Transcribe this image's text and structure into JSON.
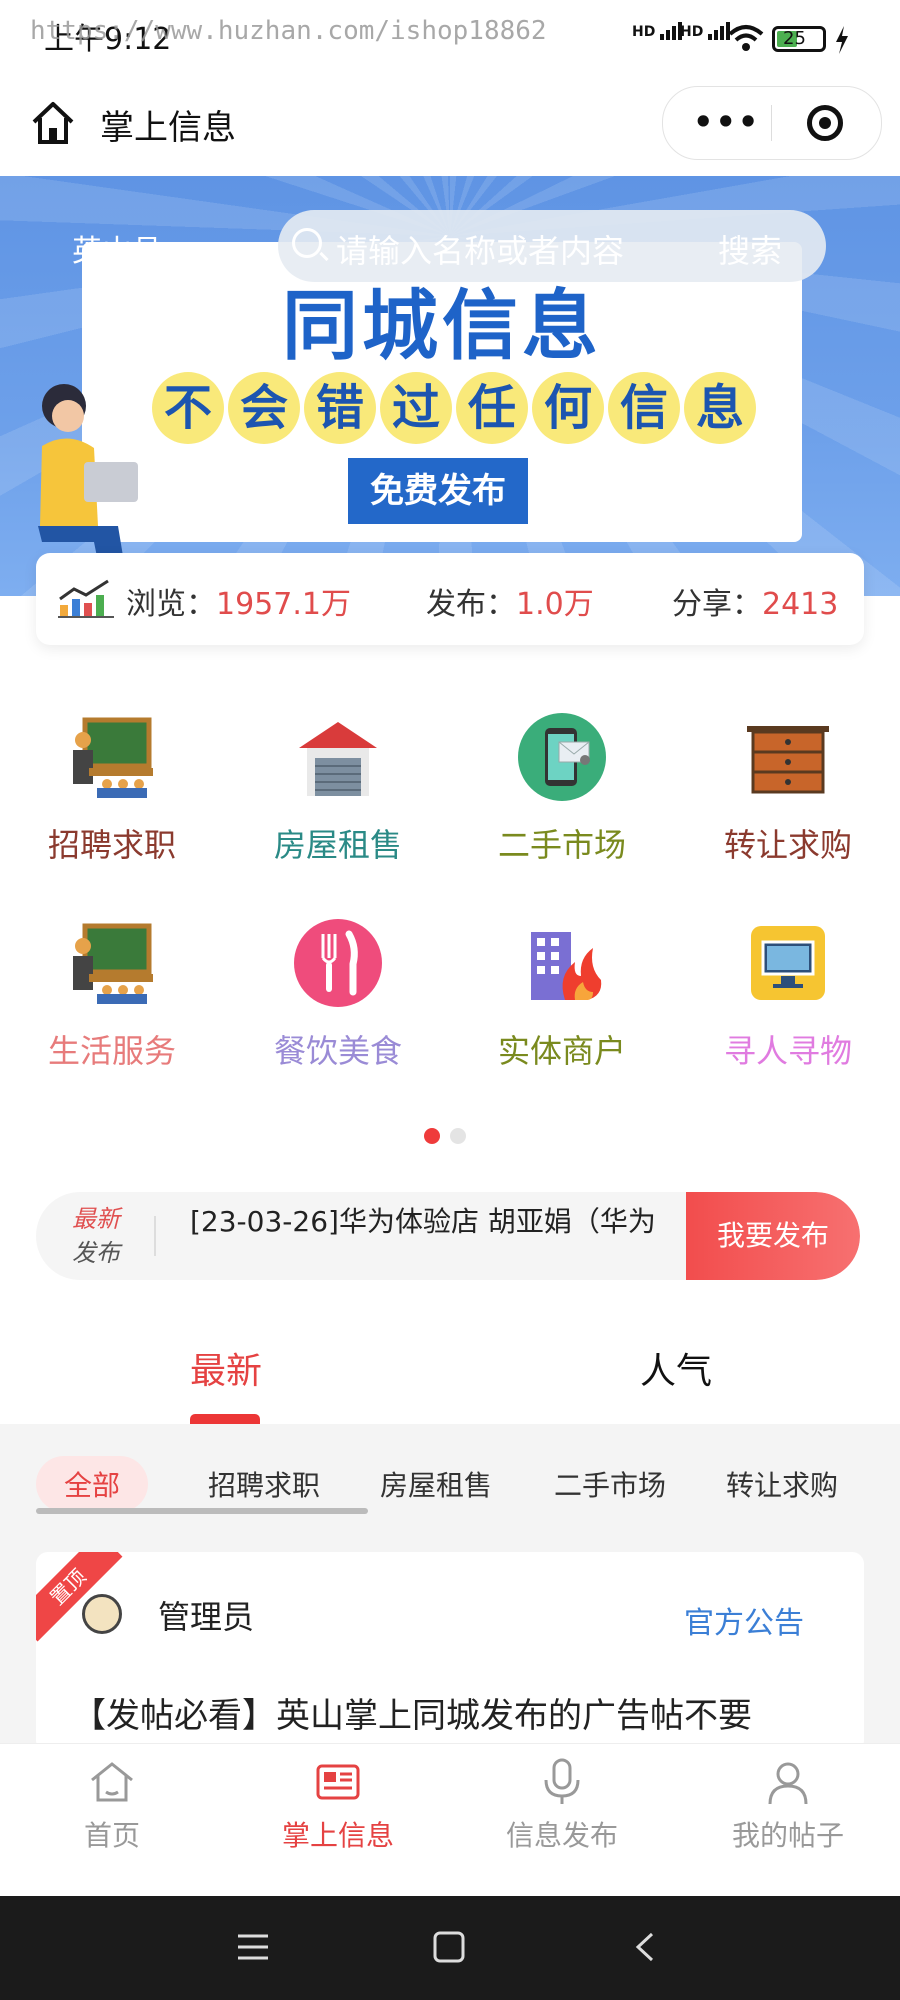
{
  "status_bar": {
    "time": "上午9:12",
    "watermark": "https://www.huzhan.com/ishop18862",
    "battery": "25"
  },
  "nav": {
    "title": "掌上信息",
    "home_icon": "home-icon",
    "more_icon": "more-dots-icon",
    "close_icon": "target-icon"
  },
  "banner": {
    "location": "英山县",
    "search_placeholder": "请输入名称或者内容",
    "search_button": "搜索",
    "headline": "同城信息",
    "slogan": [
      "不",
      "会",
      "错",
      "过",
      "任",
      "何",
      "信",
      "息"
    ],
    "free_post": "免费发布"
  },
  "stats": {
    "views_label": "浏览：",
    "views_value": "1957.1万",
    "posts_label": "发布：",
    "posts_value": "1.0万",
    "shares_label": "分享：",
    "shares_value": "2413"
  },
  "categories": [
    {
      "label": "招聘求职",
      "color": "#8b3a2e",
      "icon": "teacher-board-icon"
    },
    {
      "label": "房屋租售",
      "color": "#2a8a86",
      "icon": "house-icon"
    },
    {
      "label": "二手市场",
      "color": "#7a8a1e",
      "icon": "phone-message-icon"
    },
    {
      "label": "转让求购",
      "color": "#8b3a2e",
      "icon": "drawer-icon"
    },
    {
      "label": "生活服务",
      "color": "#e77b7b",
      "icon": "teacher-board-icon"
    },
    {
      "label": "餐饮美食",
      "color": "#9a8bd6",
      "icon": "fork-knife-icon"
    },
    {
      "label": "实体商户",
      "color": "#7a8a1e",
      "icon": "building-fire-icon"
    },
    {
      "label": "寻人寻物",
      "color": "#e07be0",
      "icon": "monitor-icon"
    }
  ],
  "ticker": {
    "tag_line1": "最新",
    "tag_line2": "发布",
    "text": "[23-03-26]华为体验店 胡亚娟（华为",
    "button": "我要发布"
  },
  "tabs": {
    "latest": "最新",
    "popular": "人气"
  },
  "filters": [
    "全部",
    "招聘求职",
    "房屋租售",
    "二手市场",
    "转让求购"
  ],
  "post": {
    "ribbon": "置顶",
    "author": "管理员",
    "category": "官方公告",
    "title": "【发帖必看】英山掌上同城发布的广告帖不要"
  },
  "tabbar": [
    {
      "label": "首页",
      "icon": "home-icon"
    },
    {
      "label": "掌上信息",
      "icon": "news-icon"
    },
    {
      "label": "信息发布",
      "icon": "microphone-icon"
    },
    {
      "label": "我的帖子",
      "icon": "user-icon"
    }
  ],
  "colors": {
    "accent": "#e54242",
    "link": "#3b7fd6",
    "banner_blue": "#1e63c8"
  }
}
